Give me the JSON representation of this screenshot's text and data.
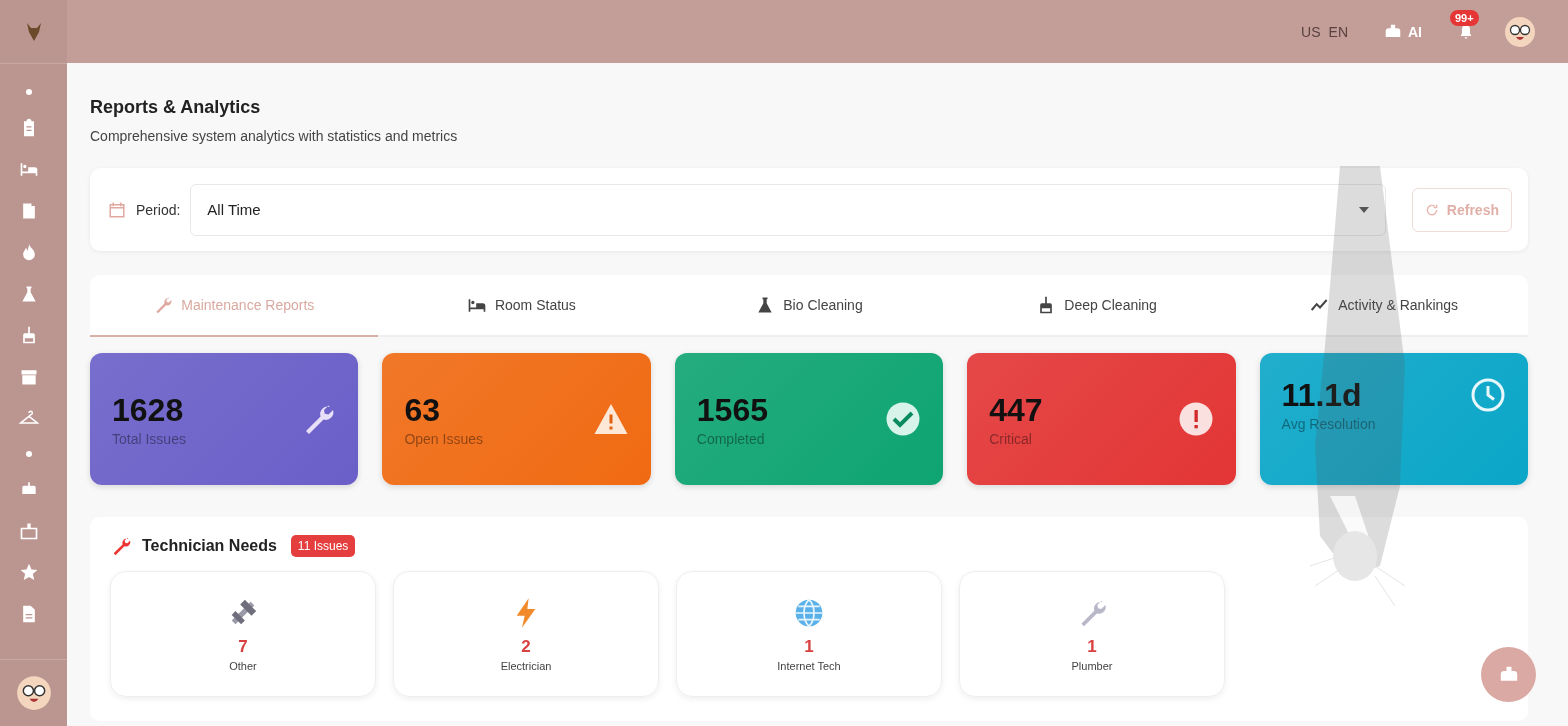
{
  "header": {
    "region": "US",
    "language": "EN",
    "assistant": "AI",
    "notifications": "99+"
  },
  "page": {
    "title": "Reports & Analytics",
    "subtitle": "Comprehensive system analytics with statistics and metrics"
  },
  "filter": {
    "label": "Period:",
    "value": "All Time",
    "refresh": "Refresh"
  },
  "tabs": [
    {
      "label": "Maintenance Reports",
      "kind": "wrench",
      "selected": true
    },
    {
      "label": "Room Status",
      "kind": "bed",
      "selected": false
    },
    {
      "label": "Bio Cleaning",
      "kind": "flask",
      "selected": false
    },
    {
      "label": "Deep Cleaning",
      "kind": "broom",
      "selected": false
    },
    {
      "label": "Activity & Rankings",
      "kind": "trend",
      "selected": false
    }
  ],
  "stats": [
    {
      "value": "1628",
      "label": "Total Issues",
      "kind": "wrench",
      "color": "#6a5fc8"
    },
    {
      "value": "63",
      "label": "Open Issues",
      "kind": "warning",
      "color": "#f06a12"
    },
    {
      "value": "1565",
      "label": "Completed",
      "kind": "check",
      "color": "#0ea472"
    },
    {
      "value": "447",
      "label": "Critical",
      "kind": "alert",
      "color": "#e33535"
    },
    {
      "value": "11.1d",
      "label": "Avg Resolution",
      "kind": "clock",
      "color": "#0aa6c8"
    }
  ],
  "technician_needs": {
    "title": "Technician Needs",
    "badge": "11 Issues",
    "items": [
      {
        "count": "7",
        "label": "Other",
        "kind": "bolt-nut"
      },
      {
        "count": "2",
        "label": "Electrician",
        "kind": "lightning"
      },
      {
        "count": "1",
        "label": "Internet Tech",
        "kind": "globe"
      },
      {
        "count": "1",
        "label": "Plumber",
        "kind": "wrench"
      }
    ]
  }
}
